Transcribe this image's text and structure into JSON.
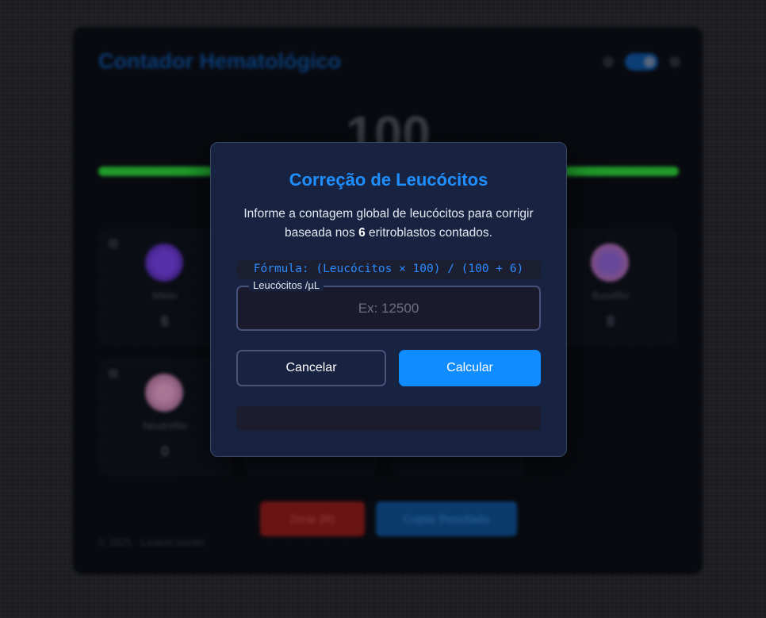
{
  "background": {
    "app_title": "Contador Hematológico",
    "total_count": "100",
    "progress_percent": 100,
    "cells": [
      {
        "name": "Mielo",
        "count": "6",
        "color": "#4a2a9a"
      },
      {
        "name": "Basófilo",
        "count": "8",
        "color": "#8a4a8a"
      },
      {
        "name": "Neutrófilo",
        "count": "0",
        "color": "#9a6a8a"
      }
    ],
    "reset_label": "Zerar (R)",
    "copy_label": "Copiar Resultado",
    "footer": "© 2025 · LeukoCounter"
  },
  "modal": {
    "title": "Correção de Leucócitos",
    "desc_prefix": "Informe a contagem global de leucócitos para corrigir baseada nos ",
    "desc_number": "6",
    "desc_suffix": " eritroblastos contados.",
    "formula": "Fórmula: (Leucócitos × 100) / (100 + 6)",
    "field_label": "Leucócitos /µL",
    "field_placeholder": "Ex: 12500",
    "field_value": "",
    "cancel_label": "Cancelar",
    "calculate_label": "Calcular",
    "result_text": ""
  },
  "colors": {
    "accent": "#1f8fff",
    "button_primary": "#0f8cff",
    "modal_bg": "#172341"
  }
}
